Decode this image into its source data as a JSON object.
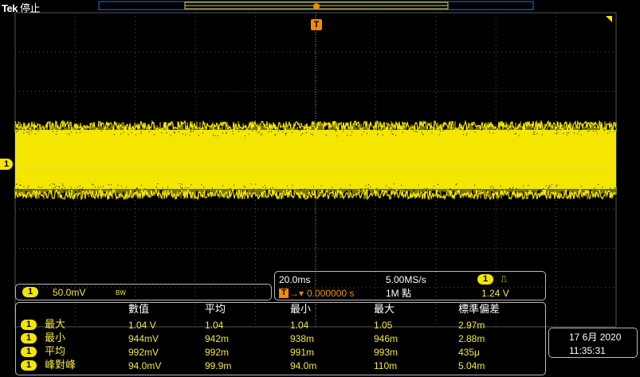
{
  "header": {
    "brand": "Tek",
    "state": "停止"
  },
  "channel": {
    "badge": "1",
    "scale": "50.0mV",
    "bw": "BW",
    "color": "#f4e600"
  },
  "trigger": {
    "marker": "T"
  },
  "timebase": {
    "scale": "20.0ms",
    "sample_rate": "5.00MS/s",
    "position": "0.000000 s",
    "record_length": "1M 點",
    "trig_channel": "1",
    "trig_slope": "⎍",
    "trig_level": "1.24 V"
  },
  "measurements": {
    "headers": [
      "數值",
      "平均",
      "最小",
      "最大",
      "標準偏差"
    ],
    "rows": [
      {
        "badge": "1",
        "label": "最大",
        "values": [
          "1.04 V",
          "1.04",
          "1.04",
          "1.05",
          "2.97m"
        ]
      },
      {
        "badge": "1",
        "label": "最小",
        "values": [
          "944mV",
          "942m",
          "938m",
          "946m",
          "2.88m"
        ]
      },
      {
        "badge": "1",
        "label": "平均",
        "values": [
          "992mV",
          "992m",
          "991m",
          "993m",
          "435μ"
        ]
      },
      {
        "badge": "1",
        "label": "峰對峰",
        "values": [
          "94.0mV",
          "99.9m",
          "94.0m",
          "110m",
          "5.04m"
        ]
      }
    ]
  },
  "datetime": {
    "date": "17 6月 2020",
    "time": "11:35:31"
  }
}
